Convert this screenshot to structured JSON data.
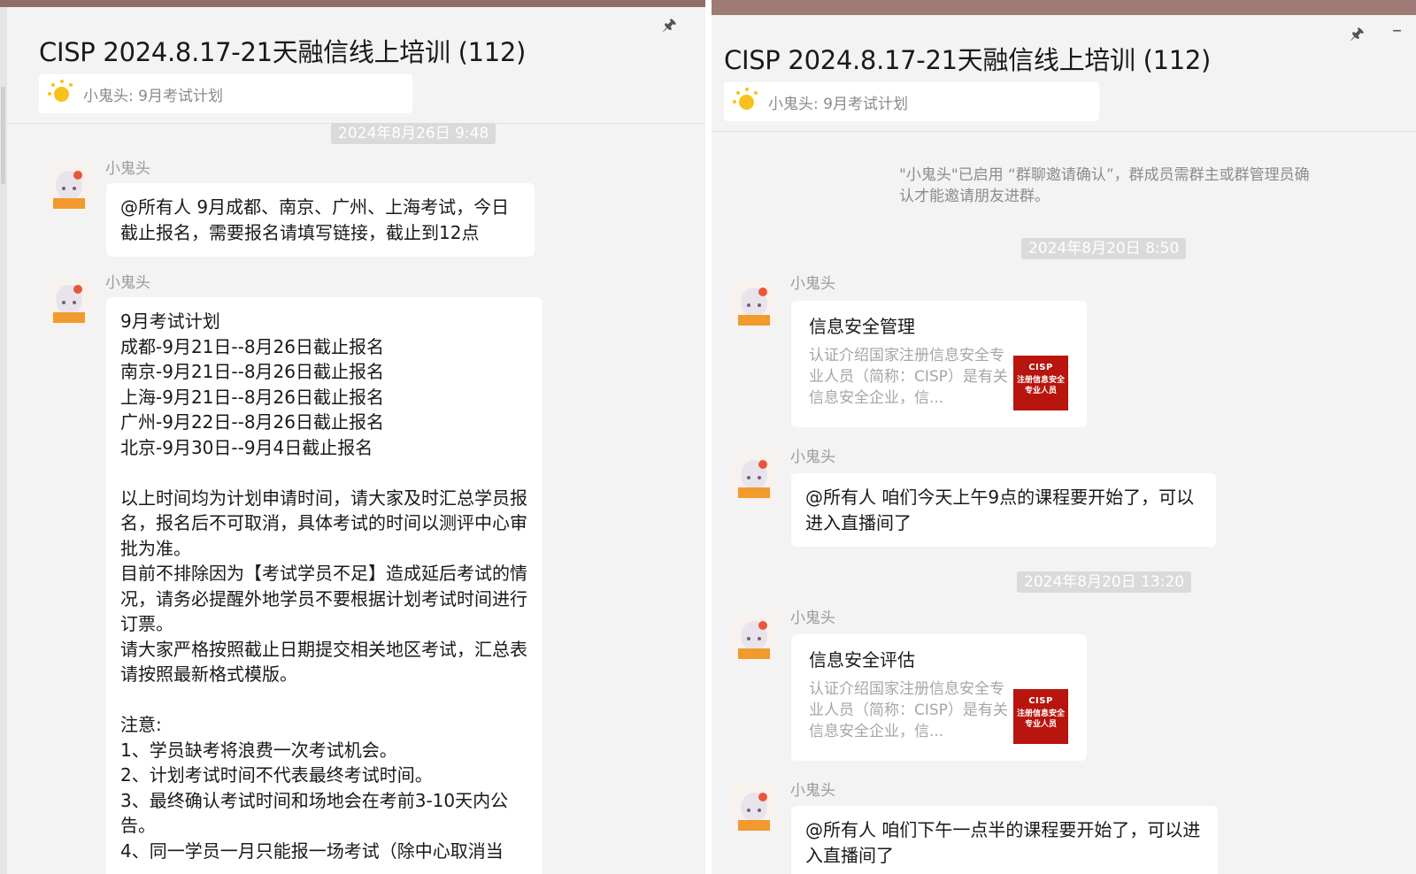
{
  "left_window": {
    "title": "CISP 2024.8.17-21天融信线上培训 (112)",
    "pin_icon": "pin-icon",
    "notice": {
      "icon": "sun-icon",
      "text": "小鬼头: 9月考试计划"
    },
    "timestamp": "2024年8月26日 9:48",
    "messages": [
      {
        "sender": "小鬼头",
        "text": "@所有人 9月成都、南京、广州、上海考试，今日截止报名，需要报名请填写链接，截止到12点"
      },
      {
        "sender": "小鬼头",
        "text": "9月考试计划\n成都-9月21日--8月26日截止报名\n南京-9月21日--8月26日截止报名\n上海-9月21日--8月26日截止报名\n广州-9月22日--8月26日截止报名\n北京-9月30日--9月4日截止报名\n\n以上时间均为计划申请时间，请大家及时汇总学员报名，报名后不可取消，具体考试的时间以测评中心审批为准。\n目前不排除因为【考试学员不足】造成延后考试的情况，请务必提醒外地学员不要根据计划考试时间进行订票。\n请大家严格按照截止日期提交相关地区考试，汇总表请按照最新格式模版。\n\n注意:\n1、学员缺考将浪费一次考试机会。\n2、计划考试时间不代表最终考试时间。\n3、最终确认考试时间和场地会在考前3-10天内公告。\n4、同一学员一月只能报一场考试（除中心取消当"
      }
    ]
  },
  "right_window": {
    "title": "CISP 2024.8.17-21天融信线上培训 (112)",
    "pin_icon": "pin-icon",
    "minimize_icon": "minimize-icon",
    "notice": {
      "icon": "sun-icon",
      "text": "小鬼头: 9月考试计划"
    },
    "system_message": "\"小鬼头\"已启用 “群聊邀请确认”，群成员需群主或群管理员确认才能邀请朋友进群。",
    "timestamps": [
      "2024年8月20日 8:50",
      "2024年8月20日 13:20"
    ],
    "messages": [
      {
        "sender": "小鬼头",
        "card_title": "信息安全管理",
        "card_desc": "认证介绍国家注册信息安全专业人员（简称：CISP）是有关信息安全企业，信...",
        "thumb_line1": "CISP",
        "thumb_line2": "注册信息安全专业人员"
      },
      {
        "sender": "小鬼头",
        "text": "@所有人 咱们今天上午9点的课程要开始了，可以进入直播间了"
      },
      {
        "sender": "小鬼头",
        "card_title": "信息安全评估",
        "card_desc": "认证介绍国家注册信息安全专业人员（简称：CISP）是有关信息安全企业，信...",
        "thumb_line1": "CISP",
        "thumb_line2": "注册信息安全专业人员"
      },
      {
        "sender": "小鬼头",
        "text": "@所有人 咱们下午一点半的课程要开始了，可以进入直播间了"
      }
    ]
  },
  "colors": {
    "background": "#f3f3f3",
    "bubble": "#ffffff",
    "timestamp_bg": "#dadada",
    "sun": "#f7c21b",
    "cisp_red": "#b8150f"
  }
}
